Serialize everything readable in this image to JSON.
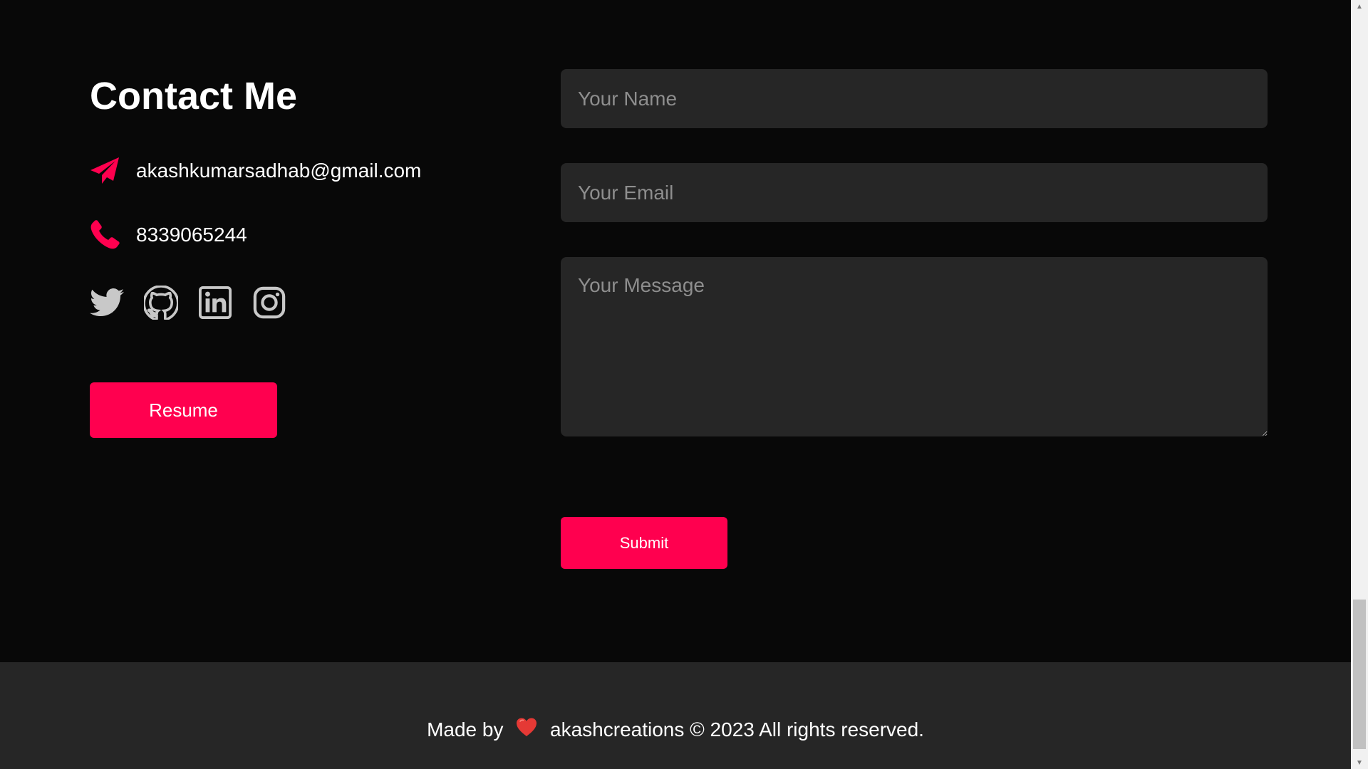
{
  "contact": {
    "title": "Contact Me",
    "email": "akashkumarsadhab@gmail.com",
    "phone": "8339065244",
    "socials": [
      "twitter-icon",
      "github-icon",
      "linkedin-icon",
      "instagram-icon"
    ],
    "resume_label": "Resume"
  },
  "form": {
    "name_placeholder": "Your Name",
    "email_placeholder": "Your Email",
    "message_placeholder": "Your Message",
    "submit_label": "Submit"
  },
  "footer": {
    "made_by": "Made by",
    "rest": "akashcreations © 2023 All rights reserved."
  },
  "colors": {
    "accent": "#ff004f",
    "background": "#080808",
    "field": "#262626",
    "footer": "#262626"
  }
}
